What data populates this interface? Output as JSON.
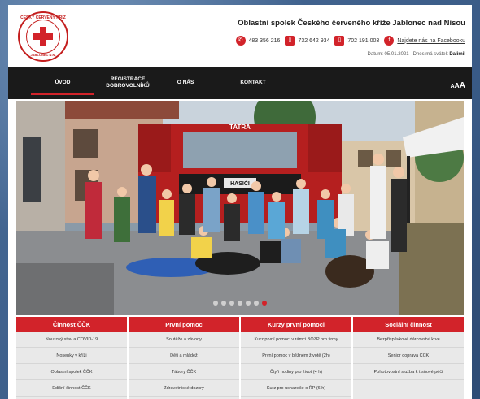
{
  "org": {
    "title": "Oblastní spolek Českého červeného kříže Jablonec nad Nisou",
    "logo_top": "ČESKÝ ČERVENÝ KŘÍŽ",
    "logo_bottom": "JABLONEC N.N."
  },
  "contacts": [
    {
      "icon": "phone-icon",
      "text": "483 356 216"
    },
    {
      "icon": "mobile-icon",
      "text": "732 642 934"
    },
    {
      "icon": "mobile-icon",
      "text": "702 191 003"
    },
    {
      "icon": "facebook-icon",
      "text": "Najdete nás na Facebooku"
    }
  ],
  "dateline": {
    "date": "Datum: 05.01.2021",
    "nameday_label": "Dnes má svátek",
    "nameday_name": "Dalimil"
  },
  "nav": {
    "items": [
      "ÚVOD",
      "REGISTRACE DOBROVOLNÍKŮ",
      "O NÁS",
      "KONTAKT"
    ],
    "active": 0,
    "font_sizes": [
      "A",
      "A",
      "A"
    ]
  },
  "hero": {
    "truck_label": "TATRA",
    "truck_sign": "HASIČI",
    "slides": 7,
    "active_slide": 6
  },
  "services": [
    {
      "title": "Činnost ČČK",
      "items": [
        "Nouzový stav a COVID-19",
        "Nosenky v kříži",
        "Oblastní spolek ČČK",
        "Ediční činnost ČČK"
      ]
    },
    {
      "title": "První pomoc",
      "items": [
        "Soutěže a závody",
        "Děti a mládež",
        "Tábory ČČK",
        "Zdravotnické dozory"
      ]
    },
    {
      "title": "Kurzy první pomoci",
      "items": [
        "Kurz první pomoci v rámci BOZP pro firmy",
        "První pomoc v běžném životě (2h)",
        "Čtyři hodiny pro život (4 h)",
        "Kurz pro uchazeče o ŘP (6 h)"
      ]
    },
    {
      "title": "Sociální činnost",
      "items": [
        "Bezpřispěvkové dárcovství krve",
        "Senior doprava ČČK",
        "Pohotovostní služba k tísňové péči"
      ]
    }
  ],
  "colors": {
    "brand_red": "#d2232a",
    "nav_bg": "#1a1a1a",
    "column_bg": "#e9e9e9"
  }
}
